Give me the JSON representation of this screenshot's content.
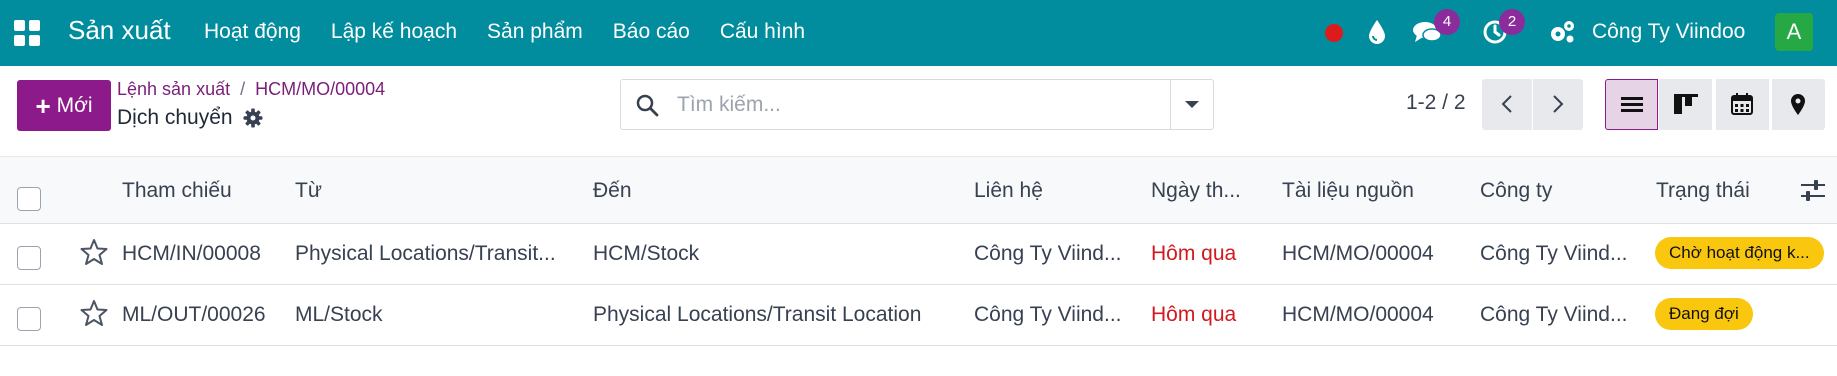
{
  "navbar": {
    "app_title": "Sản xuất",
    "menu": [
      "Hoạt động",
      "Lập kế hoạch",
      "Sản phẩm",
      "Báo cáo",
      "Cấu hình"
    ],
    "chat_count": "4",
    "activity_count": "2",
    "company": "Công Ty Viindoo",
    "avatar_letter": "A"
  },
  "control": {
    "new_label": "Mới",
    "breadcrumb": [
      "Lệnh sản xuất",
      "HCM/MO/00004"
    ],
    "current": "Dịch chuyển",
    "search_placeholder": "Tìm kiếm...",
    "pager": "1-2 / 2"
  },
  "table": {
    "columns": [
      "Tham chiếu",
      "Từ",
      "Đến",
      "Liên hệ",
      "Ngày th...",
      "Tài liệu nguồn",
      "Công ty",
      "Trạng thái"
    ],
    "rows": [
      {
        "reference": "HCM/IN/00008",
        "from": "Physical Locations/Transit...",
        "to": "HCM/Stock",
        "contact": "Công Ty Viind...",
        "date": "Hôm qua",
        "source": "HCM/MO/00004",
        "company": "Công Ty Viind...",
        "status": "Chờ hoạt động k..."
      },
      {
        "reference": "ML/OUT/00026",
        "from": "ML/Stock",
        "to": "Physical Locations/Transit Location",
        "contact": "Công Ty Viind...",
        "date": "Hôm qua",
        "source": "HCM/MO/00004",
        "company": "Công Ty Viind...",
        "status": "Đang đợi"
      }
    ]
  },
  "colors": {
    "navbar": "#018d9d",
    "primary": "#8d1a8b",
    "status_badge": "#f9c70e",
    "date_overdue": "#d2191f"
  }
}
